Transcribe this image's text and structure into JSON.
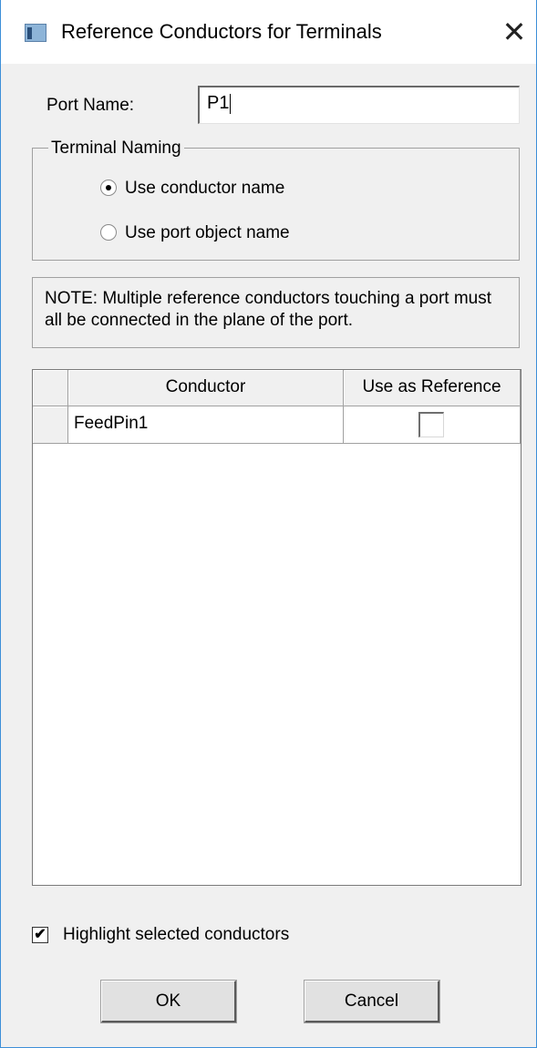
{
  "window": {
    "title": "Reference Conductors for Terminals",
    "close_glyph": "✕",
    "icon": "app-window-icon"
  },
  "port": {
    "label": "Port Name:",
    "value": "P1"
  },
  "terminal_naming": {
    "legend": "Terminal Naming",
    "options": [
      {
        "label": "Use conductor name",
        "selected": true
      },
      {
        "label": "Use port object name",
        "selected": false
      }
    ]
  },
  "note": "NOTE: Multiple reference conductors touching a port must all be connected in the plane of the port.",
  "table": {
    "columns": [
      "Conductor",
      "Use as Reference"
    ],
    "rows": [
      {
        "conductor": "FeedPin1",
        "use_as_reference": false
      }
    ]
  },
  "highlight": {
    "label": "Highlight selected conductors",
    "checked": true,
    "check_glyph": "✔"
  },
  "buttons": {
    "ok": "OK",
    "cancel": "Cancel"
  }
}
